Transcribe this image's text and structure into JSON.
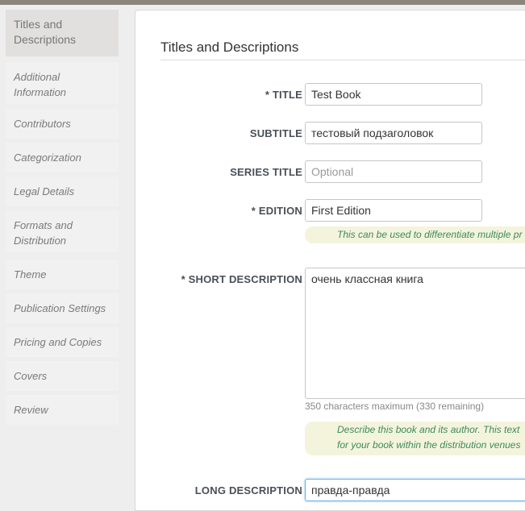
{
  "sidebar": {
    "items": [
      {
        "label": "Titles and Descriptions"
      },
      {
        "label": "Additional Information"
      },
      {
        "label": "Contributors"
      },
      {
        "label": "Categorization"
      },
      {
        "label": "Legal Details"
      },
      {
        "label": "Formats and Distribution"
      },
      {
        "label": "Theme"
      },
      {
        "label": "Publication Settings"
      },
      {
        "label": "Pricing and Copies"
      },
      {
        "label": "Covers"
      },
      {
        "label": "Review"
      }
    ]
  },
  "main": {
    "title": "Titles and Descriptions",
    "fields": {
      "title": {
        "label": "* TITLE",
        "value": "Test Book"
      },
      "subtitle": {
        "label": "SUBTITLE",
        "value": "тестовый подзаголовок"
      },
      "series_title": {
        "label": "SERIES TITLE",
        "value": "",
        "placeholder": "Optional"
      },
      "edition": {
        "label": "* EDITION",
        "value": "First Edition",
        "hint": "This can be used to differentiate multiple pr"
      },
      "short_description": {
        "label": "* SHORT DESCRIPTION",
        "value": "очень классная книга",
        "counter": "350 characters maximum (330 remaining)",
        "hint_line1": "Describe this book and its author. This text",
        "hint_line2": "for your book within the distribution venues"
      },
      "long_description": {
        "label": "LONG DESCRIPTION",
        "value": "правда-правда"
      }
    }
  }
}
